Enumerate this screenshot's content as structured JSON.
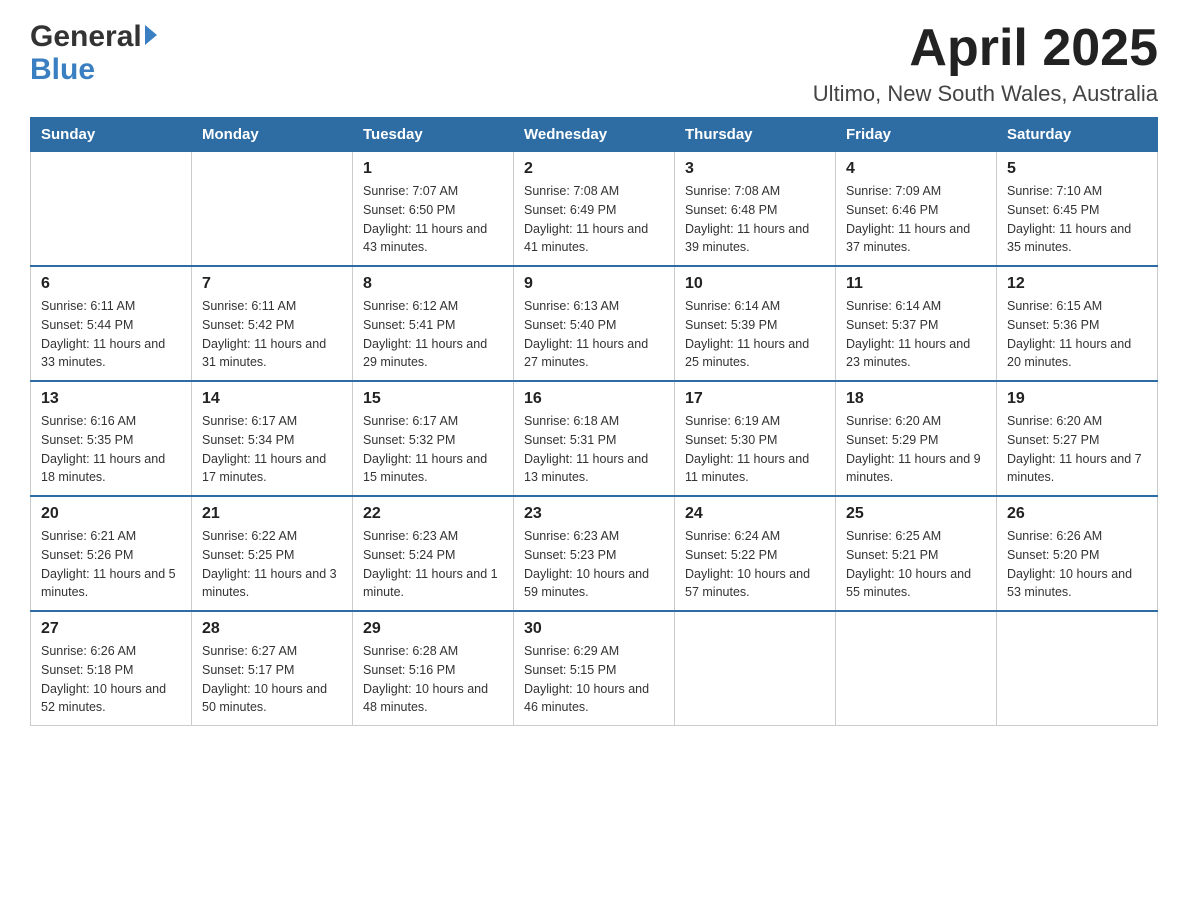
{
  "header": {
    "logo_general": "General",
    "logo_blue": "Blue",
    "month_title": "April 2025",
    "location": "Ultimo, New South Wales, Australia"
  },
  "days_of_week": [
    "Sunday",
    "Monday",
    "Tuesday",
    "Wednesday",
    "Thursday",
    "Friday",
    "Saturday"
  ],
  "weeks": [
    [
      {
        "day": "",
        "sunrise": "",
        "sunset": "",
        "daylight": ""
      },
      {
        "day": "",
        "sunrise": "",
        "sunset": "",
        "daylight": ""
      },
      {
        "day": "1",
        "sunrise": "Sunrise: 7:07 AM",
        "sunset": "Sunset: 6:50 PM",
        "daylight": "Daylight: 11 hours and 43 minutes."
      },
      {
        "day": "2",
        "sunrise": "Sunrise: 7:08 AM",
        "sunset": "Sunset: 6:49 PM",
        "daylight": "Daylight: 11 hours and 41 minutes."
      },
      {
        "day": "3",
        "sunrise": "Sunrise: 7:08 AM",
        "sunset": "Sunset: 6:48 PM",
        "daylight": "Daylight: 11 hours and 39 minutes."
      },
      {
        "day": "4",
        "sunrise": "Sunrise: 7:09 AM",
        "sunset": "Sunset: 6:46 PM",
        "daylight": "Daylight: 11 hours and 37 minutes."
      },
      {
        "day": "5",
        "sunrise": "Sunrise: 7:10 AM",
        "sunset": "Sunset: 6:45 PM",
        "daylight": "Daylight: 11 hours and 35 minutes."
      }
    ],
    [
      {
        "day": "6",
        "sunrise": "Sunrise: 6:11 AM",
        "sunset": "Sunset: 5:44 PM",
        "daylight": "Daylight: 11 hours and 33 minutes."
      },
      {
        "day": "7",
        "sunrise": "Sunrise: 6:11 AM",
        "sunset": "Sunset: 5:42 PM",
        "daylight": "Daylight: 11 hours and 31 minutes."
      },
      {
        "day": "8",
        "sunrise": "Sunrise: 6:12 AM",
        "sunset": "Sunset: 5:41 PM",
        "daylight": "Daylight: 11 hours and 29 minutes."
      },
      {
        "day": "9",
        "sunrise": "Sunrise: 6:13 AM",
        "sunset": "Sunset: 5:40 PM",
        "daylight": "Daylight: 11 hours and 27 minutes."
      },
      {
        "day": "10",
        "sunrise": "Sunrise: 6:14 AM",
        "sunset": "Sunset: 5:39 PM",
        "daylight": "Daylight: 11 hours and 25 minutes."
      },
      {
        "day": "11",
        "sunrise": "Sunrise: 6:14 AM",
        "sunset": "Sunset: 5:37 PM",
        "daylight": "Daylight: 11 hours and 23 minutes."
      },
      {
        "day": "12",
        "sunrise": "Sunrise: 6:15 AM",
        "sunset": "Sunset: 5:36 PM",
        "daylight": "Daylight: 11 hours and 20 minutes."
      }
    ],
    [
      {
        "day": "13",
        "sunrise": "Sunrise: 6:16 AM",
        "sunset": "Sunset: 5:35 PM",
        "daylight": "Daylight: 11 hours and 18 minutes."
      },
      {
        "day": "14",
        "sunrise": "Sunrise: 6:17 AM",
        "sunset": "Sunset: 5:34 PM",
        "daylight": "Daylight: 11 hours and 17 minutes."
      },
      {
        "day": "15",
        "sunrise": "Sunrise: 6:17 AM",
        "sunset": "Sunset: 5:32 PM",
        "daylight": "Daylight: 11 hours and 15 minutes."
      },
      {
        "day": "16",
        "sunrise": "Sunrise: 6:18 AM",
        "sunset": "Sunset: 5:31 PM",
        "daylight": "Daylight: 11 hours and 13 minutes."
      },
      {
        "day": "17",
        "sunrise": "Sunrise: 6:19 AM",
        "sunset": "Sunset: 5:30 PM",
        "daylight": "Daylight: 11 hours and 11 minutes."
      },
      {
        "day": "18",
        "sunrise": "Sunrise: 6:20 AM",
        "sunset": "Sunset: 5:29 PM",
        "daylight": "Daylight: 11 hours and 9 minutes."
      },
      {
        "day": "19",
        "sunrise": "Sunrise: 6:20 AM",
        "sunset": "Sunset: 5:27 PM",
        "daylight": "Daylight: 11 hours and 7 minutes."
      }
    ],
    [
      {
        "day": "20",
        "sunrise": "Sunrise: 6:21 AM",
        "sunset": "Sunset: 5:26 PM",
        "daylight": "Daylight: 11 hours and 5 minutes."
      },
      {
        "day": "21",
        "sunrise": "Sunrise: 6:22 AM",
        "sunset": "Sunset: 5:25 PM",
        "daylight": "Daylight: 11 hours and 3 minutes."
      },
      {
        "day": "22",
        "sunrise": "Sunrise: 6:23 AM",
        "sunset": "Sunset: 5:24 PM",
        "daylight": "Daylight: 11 hours and 1 minute."
      },
      {
        "day": "23",
        "sunrise": "Sunrise: 6:23 AM",
        "sunset": "Sunset: 5:23 PM",
        "daylight": "Daylight: 10 hours and 59 minutes."
      },
      {
        "day": "24",
        "sunrise": "Sunrise: 6:24 AM",
        "sunset": "Sunset: 5:22 PM",
        "daylight": "Daylight: 10 hours and 57 minutes."
      },
      {
        "day": "25",
        "sunrise": "Sunrise: 6:25 AM",
        "sunset": "Sunset: 5:21 PM",
        "daylight": "Daylight: 10 hours and 55 minutes."
      },
      {
        "day": "26",
        "sunrise": "Sunrise: 6:26 AM",
        "sunset": "Sunset: 5:20 PM",
        "daylight": "Daylight: 10 hours and 53 minutes."
      }
    ],
    [
      {
        "day": "27",
        "sunrise": "Sunrise: 6:26 AM",
        "sunset": "Sunset: 5:18 PM",
        "daylight": "Daylight: 10 hours and 52 minutes."
      },
      {
        "day": "28",
        "sunrise": "Sunrise: 6:27 AM",
        "sunset": "Sunset: 5:17 PM",
        "daylight": "Daylight: 10 hours and 50 minutes."
      },
      {
        "day": "29",
        "sunrise": "Sunrise: 6:28 AM",
        "sunset": "Sunset: 5:16 PM",
        "daylight": "Daylight: 10 hours and 48 minutes."
      },
      {
        "day": "30",
        "sunrise": "Sunrise: 6:29 AM",
        "sunset": "Sunset: 5:15 PM",
        "daylight": "Daylight: 10 hours and 46 minutes."
      },
      {
        "day": "",
        "sunrise": "",
        "sunset": "",
        "daylight": ""
      },
      {
        "day": "",
        "sunrise": "",
        "sunset": "",
        "daylight": ""
      },
      {
        "day": "",
        "sunrise": "",
        "sunset": "",
        "daylight": ""
      }
    ]
  ]
}
